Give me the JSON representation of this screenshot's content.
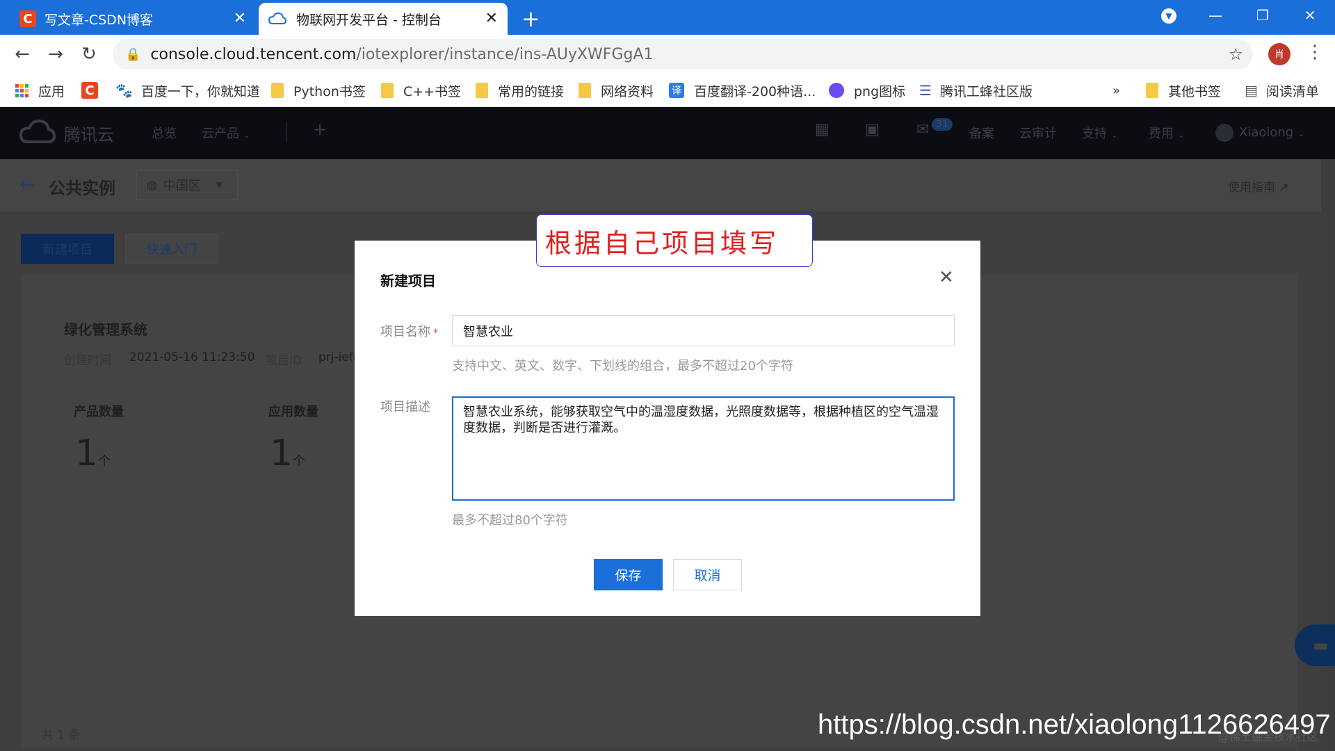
{
  "browser": {
    "tabs": [
      {
        "title": "写文章-CSDN博客",
        "favicon": "C"
      },
      {
        "title": "物联网开发平台 - 控制台"
      }
    ],
    "new_tab": "+",
    "url_domain": "console.cloud.tencent.com",
    "url_path": "/iotexplorer/instance/ins-AUyXWFGgA1",
    "profile_initial": "肖",
    "bookmarks": [
      {
        "label": "应用"
      },
      {
        "label": "百度一下，你就知道"
      },
      {
        "label": "Python书签"
      },
      {
        "label": "C++书签"
      },
      {
        "label": "常用的链接"
      },
      {
        "label": "网络资料"
      },
      {
        "label": "百度翻译-200种语..."
      },
      {
        "label": "png图标"
      },
      {
        "label": "腾讯工蜂社区版"
      },
      {
        "label": "其他书签"
      },
      {
        "label": "阅读清单"
      }
    ],
    "bookmarks_more": "»",
    "translate_badge": "译"
  },
  "console": {
    "brand": "腾讯云",
    "nav": [
      "总览",
      "云产品",
      "备案",
      "云审计",
      "支持",
      "费用"
    ],
    "mail_count": "31",
    "user": "Xiaolong",
    "page_title": "公共实例",
    "region": "中国区",
    "guide": "使用指南",
    "btn_new": "新建项目",
    "btn_quick": "快速入门",
    "project": {
      "name": "绿化管理系统",
      "created_label": "创建时间",
      "created_value": "2021-05-16 11:23:50",
      "id_label": "项目ID",
      "id_value": "prj-iefr",
      "product_label": "产品数量",
      "product_count": "1",
      "app_label": "应用数量",
      "app_count": "1",
      "unit": "个"
    },
    "total": "共 1 条"
  },
  "modal": {
    "title": "新建项目",
    "name_label": "项目名称",
    "required_mark": "*",
    "name_value": "智慧农业",
    "name_hint": "支持中文、英文、数字、下划线的组合，最多不超过20个字符",
    "desc_label": "项目描述",
    "desc_value": "智慧农业系统，能够获取空气中的温湿度数据，光照度数据等，根据种植区的空气温湿度数据，判断是否进行灌溉。",
    "desc_hint": "最多不超过80个字符",
    "save": "保存",
    "cancel": "取消"
  },
  "annotation": "根据自己项目填写",
  "watermark": "https://blog.csdn.net/xiaolong1126626497",
  "watermark_faint": "@稀土掘金技术社区"
}
